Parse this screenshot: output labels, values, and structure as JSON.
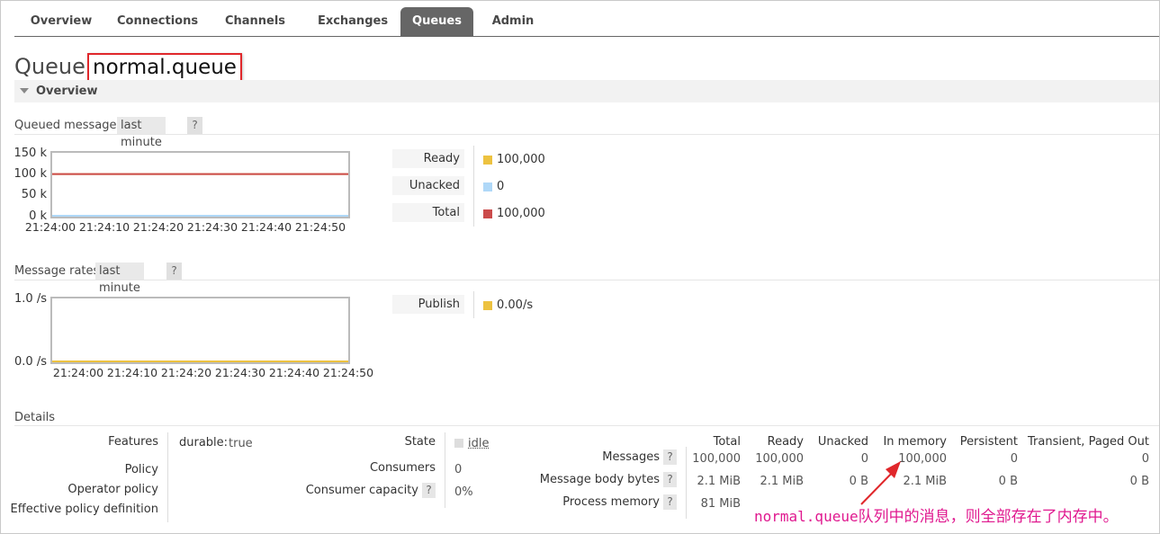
{
  "tabs": [
    "Overview",
    "Connections",
    "Channels",
    "Exchanges",
    "Queues",
    "Admin"
  ],
  "active_tab": "Queues",
  "header": {
    "prefix": "Queue",
    "name": "normal.queue"
  },
  "overview_section": "Overview",
  "queued_messages": {
    "label": "Queued messages",
    "range": "last minute",
    "help": "?",
    "chart_data": {
      "type": "line",
      "x": [
        "21:24:00",
        "21:24:10",
        "21:24:20",
        "21:24:30",
        "21:24:40",
        "21:24:50"
      ],
      "y_ticks": [
        "150 k",
        "100 k",
        "50 k",
        "0 k"
      ],
      "ylim": [
        0,
        150000
      ],
      "series": [
        {
          "name": "Ready",
          "color": "#edc240",
          "values": [
            100000,
            100000,
            100000,
            100000,
            100000,
            100000
          ]
        },
        {
          "name": "Unacked",
          "color": "#afd8f8",
          "values": [
            0,
            0,
            0,
            0,
            0,
            0
          ]
        },
        {
          "name": "Total",
          "color": "#cb4b4b",
          "values": [
            100000,
            100000,
            100000,
            100000,
            100000,
            100000
          ]
        }
      ]
    },
    "legend": [
      {
        "label": "Ready",
        "value": "100,000",
        "color": "#edc240"
      },
      {
        "label": "Unacked",
        "value": "0",
        "color": "#afd8f8"
      },
      {
        "label": "Total",
        "value": "100,000",
        "color": "#cb4b4b"
      }
    ]
  },
  "message_rates": {
    "label": "Message rates",
    "range": "last minute",
    "help": "?",
    "chart_data": {
      "type": "line",
      "x": [
        "21:24:00",
        "21:24:10",
        "21:24:20",
        "21:24:30",
        "21:24:40",
        "21:24:50"
      ],
      "y_ticks": [
        "1.0 /s",
        "0.0 /s"
      ],
      "ylim": [
        0,
        1
      ],
      "series": [
        {
          "name": "Publish",
          "color": "#edc240",
          "values": [
            0,
            0,
            0,
            0,
            0,
            0
          ]
        }
      ]
    },
    "legend": [
      {
        "label": "Publish",
        "value": "0.00/s",
        "color": "#edc240"
      }
    ]
  },
  "details": {
    "title": "Details",
    "features_label": "Features",
    "features_key": "durable:",
    "features_value": "true",
    "policy_label": "Policy",
    "operator_policy_label": "Operator policy",
    "effective_policy_label": "Effective policy definition",
    "state_label": "State",
    "state_value": "idle",
    "consumers_label": "Consumers",
    "consumers_value": "0",
    "consumer_capacity_label": "Consumer capacity",
    "consumer_capacity_value": "0%",
    "help": "?",
    "columns": [
      "Total",
      "Ready",
      "Unacked",
      "In memory",
      "Persistent",
      "Transient, Paged Out"
    ],
    "rows": [
      {
        "label": "Messages",
        "values": [
          "100,000",
          "100,000",
          "0",
          "100,000",
          "0",
          "0"
        ]
      },
      {
        "label": "Message body bytes",
        "values": [
          "2.1 MiB",
          "2.1 MiB",
          "0 B",
          "2.1 MiB",
          "0 B",
          "0 B"
        ]
      },
      {
        "label": "Process memory",
        "values": [
          "81 MiB"
        ]
      }
    ]
  },
  "annotation": {
    "code": "normal.queue",
    "text": "队列中的消息，则全部存在了内存中。"
  }
}
